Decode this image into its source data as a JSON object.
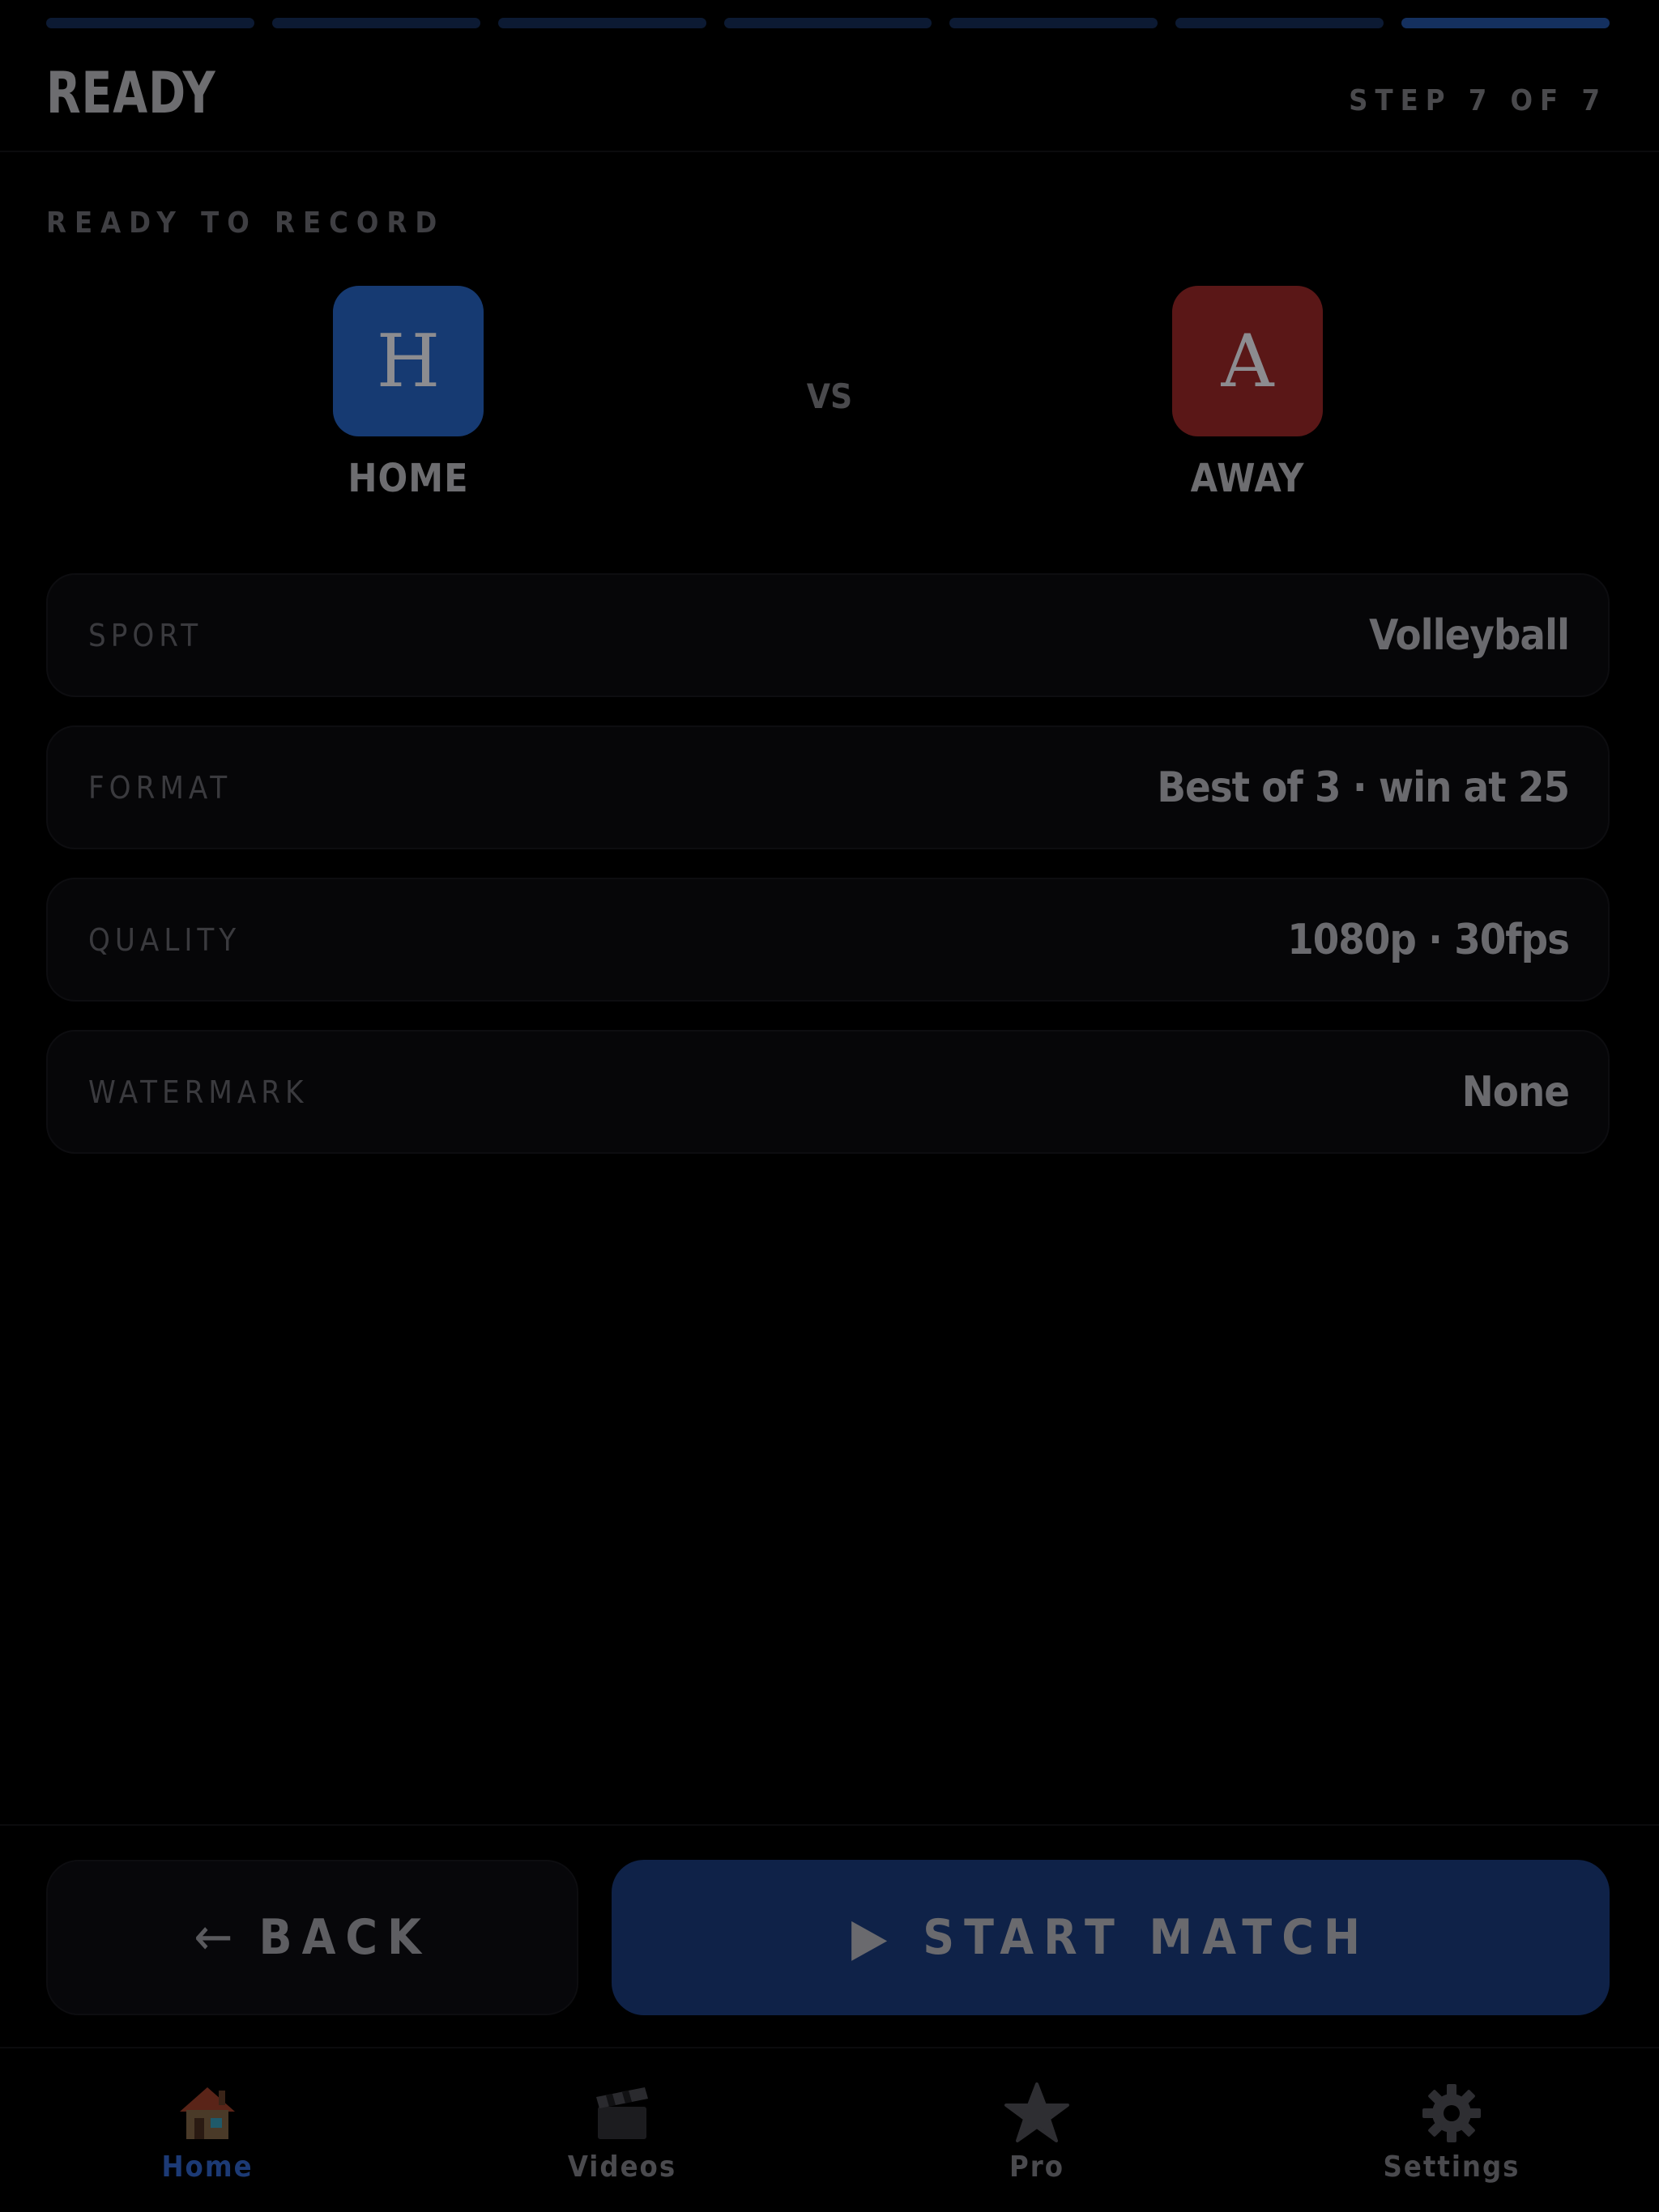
{
  "progress": {
    "total_steps": 7,
    "current_step": 7
  },
  "header": {
    "title": "READY",
    "step_label": "STEP 7 OF 7"
  },
  "section_label": "READY TO RECORD",
  "teams": {
    "home": {
      "initial": "H",
      "name": "HOME",
      "color": "#163a72"
    },
    "vs": "VS",
    "away": {
      "initial": "A",
      "name": "AWAY",
      "color": "#5a1717"
    }
  },
  "summary": [
    {
      "label": "SPORT",
      "value": "Volleyball"
    },
    {
      "label": "FORMAT",
      "value": "Best of 3 · win at 25"
    },
    {
      "label": "QUALITY",
      "value": "1080p · 30fps"
    },
    {
      "label": "WATERMARK",
      "value": "None"
    }
  ],
  "actions": {
    "back": {
      "icon": "←",
      "label": "BACK"
    },
    "start": {
      "icon": "▶",
      "label": "START MATCH"
    }
  },
  "nav": [
    {
      "label": "Home",
      "icon": "house-icon",
      "active": true
    },
    {
      "label": "Videos",
      "icon": "clapperboard-icon",
      "active": false
    },
    {
      "label": "Pro",
      "icon": "star-icon",
      "active": false
    },
    {
      "label": "Settings",
      "icon": "gear-icon",
      "active": false
    }
  ],
  "colors": {
    "accent": "#1c3a75",
    "background": "#000000"
  }
}
